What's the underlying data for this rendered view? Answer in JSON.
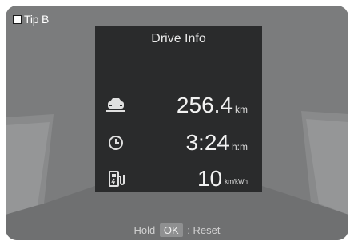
{
  "tag": {
    "label": "Tip B"
  },
  "panel": {
    "title": "Drive Info",
    "rows": [
      {
        "icon": "car-distance-icon",
        "value": "256.4",
        "unit": "km"
      },
      {
        "icon": "clock-icon",
        "value": "3:24",
        "unit": "h:m"
      },
      {
        "icon": "charging-station-icon",
        "value": "10",
        "unit": "km/kWh"
      }
    ]
  },
  "footer": {
    "hold": "Hold",
    "ok": "OK",
    "reset": ": Reset"
  },
  "colors": {
    "screen_bg": "#7b7c7d",
    "panel_bg": "#2a2b2c",
    "text": "#f2f2f2"
  }
}
